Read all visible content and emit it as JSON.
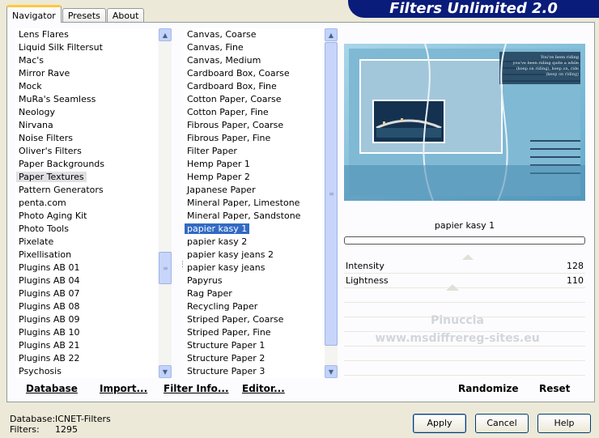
{
  "banner": "Filters Unlimited 2.0",
  "tabs": [
    "Navigator",
    "Presets",
    "About"
  ],
  "categories": [
    "Lens Flares",
    "Liquid Silk Filtersut",
    "Mac's",
    "Mirror Rave",
    "Mock",
    "MuRa's Seamless",
    "Neology",
    "Nirvana",
    "Noise Filters",
    "Oliver's Filters",
    "Paper Backgrounds",
    "Paper Textures",
    "Pattern Generators",
    "penta.com",
    "Photo Aging Kit",
    "Photo Tools",
    "Pixelate",
    "Pixellisation",
    "Plugins AB 01",
    "Plugins AB 04",
    "Plugins AB 07",
    "Plugins AB 08",
    "Plugins AB 09",
    "Plugins AB 10",
    "Plugins AB 21",
    "Plugins AB 22",
    "Psychosis"
  ],
  "selected_category": "Paper Textures",
  "filters": [
    "Canvas, Coarse",
    "Canvas, Fine",
    "Canvas, Medium",
    "Cardboard Box, Coarse",
    "Cardboard Box, Fine",
    "Cotton Paper, Coarse",
    "Cotton Paper, Fine",
    "Fibrous Paper, Coarse",
    "Fibrous Paper, Fine",
    "Filter Paper",
    "Hemp Paper 1",
    "Hemp Paper 2",
    "Japanese Paper",
    "Mineral Paper, Limestone",
    "Mineral Paper, Sandstone",
    "papier kasy 1",
    "papier kasy 2",
    "papier kasy jeans 2",
    "papier kasy jeans",
    "Papyrus",
    "Rag Paper",
    "Recycling Paper",
    "Striped Paper, Coarse",
    "Striped Paper, Fine",
    "Structure Paper 1",
    "Structure Paper 2",
    "Structure Paper 3"
  ],
  "selected_filter": "papier kasy 1",
  "toolbar": {
    "database": "Database",
    "import": "Import...",
    "filter_info": "Filter Info...",
    "editor": "Editor..."
  },
  "preview": {
    "filter_name": "papier kasy 1",
    "caption_lines": [
      "You've been riding",
      "you've been riding quite a while",
      "(keep on riding), keep on, ride",
      "(keep on riding)"
    ]
  },
  "sliders": [
    {
      "label": "Intensity",
      "value": "128",
      "level": 0.502
    },
    {
      "label": "Lightness",
      "value": "110",
      "level": 0.431
    }
  ],
  "watermark": [
    "Pinuccia",
    "www.msdiffrereg-sites.eu"
  ],
  "actions": {
    "randomize": "Randomize",
    "reset": "Reset"
  },
  "status": {
    "database_label": "Database:",
    "database_value": "ICNET-Filters",
    "filters_label": "Filters:",
    "filters_value": "1295"
  },
  "buttons": {
    "apply": "Apply",
    "cancel": "Cancel",
    "help": "Help"
  }
}
